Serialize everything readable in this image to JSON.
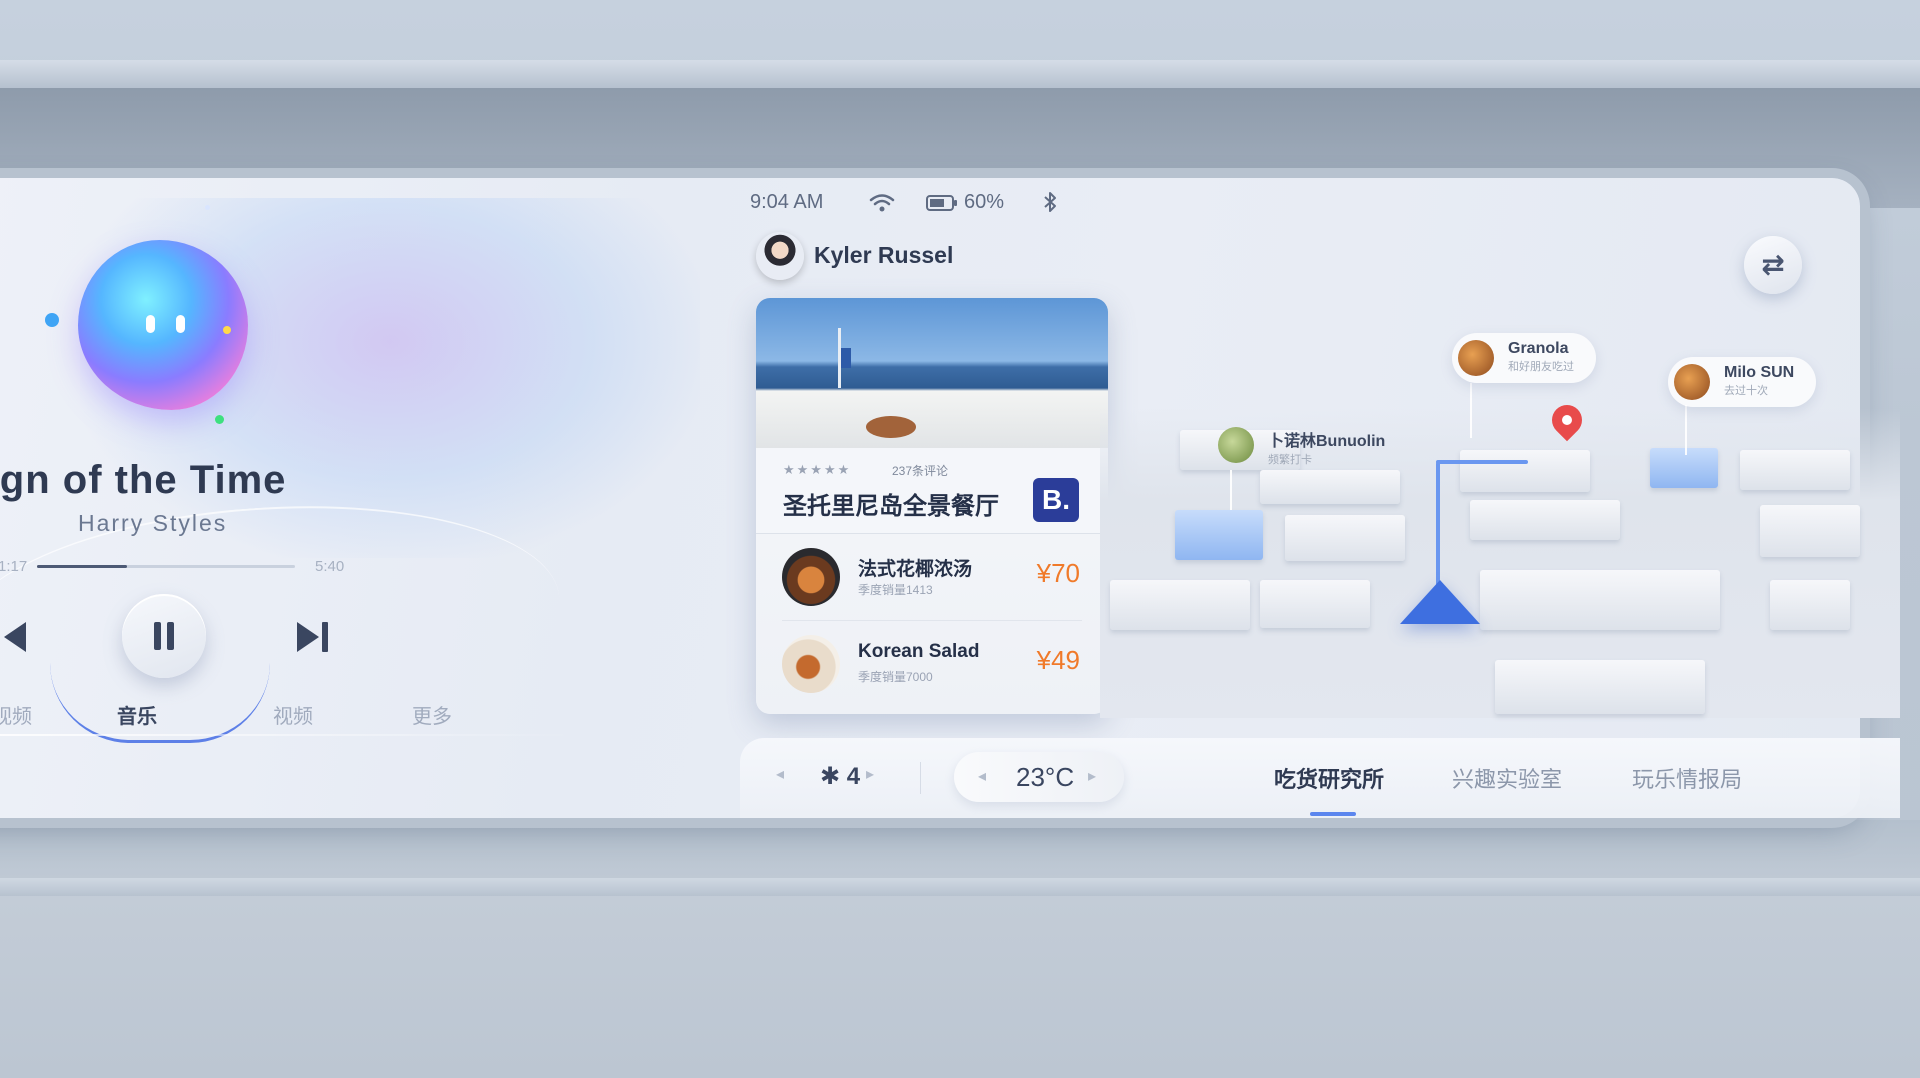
{
  "status": {
    "time": "9:04 AM",
    "battery": "60%"
  },
  "music": {
    "title": "Sign of the Time",
    "artist": "Harry Styles",
    "elapsed": "1:17",
    "duration": "5:40",
    "progress": 0.35,
    "tabs": [
      "视频",
      "音乐",
      "视频",
      "更多"
    ]
  },
  "user": {
    "name": "Kyler Russel"
  },
  "restaurant": {
    "stars": "★★★★★",
    "reviews": "237条评论",
    "name": "圣托里尼岛全景餐厅",
    "badge": "B.",
    "dishes": [
      {
        "name": "法式花椰浓汤",
        "sales": "季度销量1413",
        "price": "¥70"
      },
      {
        "name": "Korean Salad",
        "sales": "季度销量7000",
        "price": "¥49"
      }
    ]
  },
  "map": {
    "pois": [
      {
        "name": "Granola",
        "sub": "和好朋友吃过"
      },
      {
        "name": "Milo SUN",
        "sub": "去过十次"
      },
      {
        "name": "卜诺林Bunuolin",
        "sub": "频繁打卡"
      }
    ]
  },
  "climate": {
    "fan_level": "4",
    "temperature": "23°C"
  },
  "nav_tabs": [
    "吃货研究所",
    "兴趣实验室",
    "玩乐情报局"
  ],
  "colors": {
    "accent": "#5b86ee",
    "price": "#f07a2a",
    "badge": "#2b3d99"
  }
}
